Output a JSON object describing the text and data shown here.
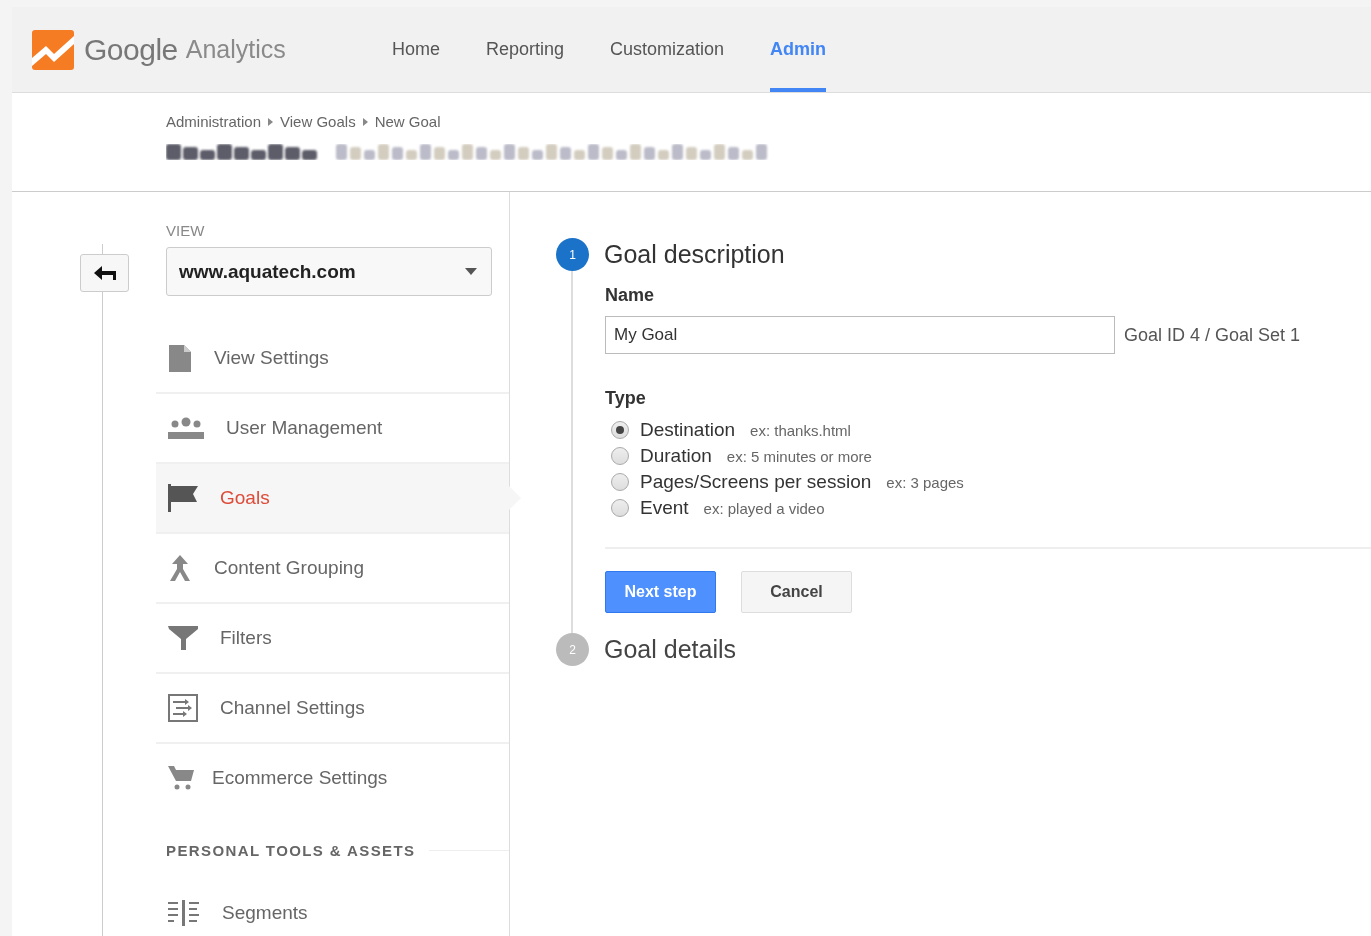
{
  "header": {
    "brand": {
      "name": "Google",
      "product": "Analytics"
    },
    "nav": [
      {
        "label": "Home",
        "selected": false
      },
      {
        "label": "Reporting",
        "selected": false
      },
      {
        "label": "Customization",
        "selected": false
      },
      {
        "label": "Admin",
        "selected": true
      }
    ]
  },
  "breadcrumbs": [
    "Administration",
    "View Goals",
    "New Goal"
  ],
  "sidebar": {
    "view_label": "VIEW",
    "view_select": "www.aquatech.com",
    "items": [
      {
        "label": "View Settings",
        "kind": "document",
        "selected": false
      },
      {
        "label": "User Management",
        "kind": "users",
        "selected": false
      },
      {
        "label": "Goals",
        "kind": "flag",
        "selected": true
      },
      {
        "label": "Content Grouping",
        "kind": "grouping",
        "selected": false
      },
      {
        "label": "Filters",
        "kind": "filter",
        "selected": false
      },
      {
        "label": "Channel Settings",
        "kind": "channel",
        "selected": false
      },
      {
        "label": "Ecommerce Settings",
        "kind": "cart",
        "selected": false
      }
    ],
    "section_title": "PERSONAL TOOLS & ASSETS",
    "section_items": [
      {
        "label": "Segments",
        "kind": "segments",
        "selected": false
      }
    ]
  },
  "form": {
    "steps": [
      {
        "number": "1",
        "title": "Goal description",
        "active": true
      },
      {
        "number": "2",
        "title": "Goal details",
        "active": false
      }
    ],
    "name_label": "Name",
    "name_value": "My Goal",
    "goal_id": "Goal ID 4 / Goal Set 1",
    "type_label": "Type",
    "types": [
      {
        "label": "Destination",
        "example": "ex: thanks.html",
        "selected": true
      },
      {
        "label": "Duration",
        "example": "ex: 5 minutes or more",
        "selected": false
      },
      {
        "label": "Pages/Screens per session",
        "example": "ex: 3 pages",
        "selected": false
      },
      {
        "label": "Event",
        "example": "ex: played a video",
        "selected": false
      }
    ],
    "buttons": [
      {
        "label": "Next step",
        "kind": "primary"
      },
      {
        "label": "Cancel",
        "kind": "secondary"
      }
    ]
  }
}
